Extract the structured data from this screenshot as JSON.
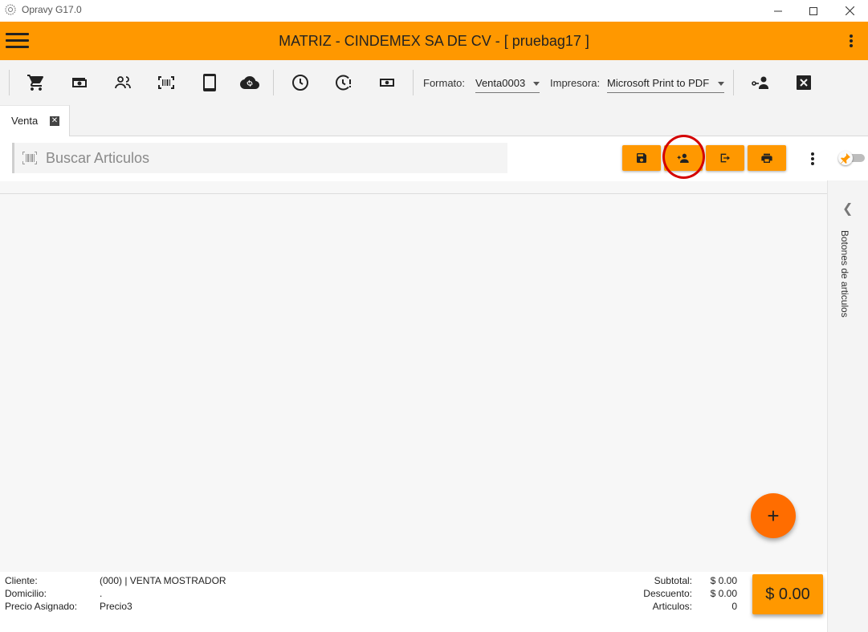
{
  "window": {
    "title": "Opravy G17.0"
  },
  "appbar": {
    "title": "MATRIZ - CINDEMEX SA DE CV - [ pruebag17 ]"
  },
  "toolbar": {
    "formato_label": "Formato:",
    "formato_value": "Venta0003",
    "impresora_label": "Impresora:",
    "impresora_value": "Microsoft Print to PDF"
  },
  "tabs": [
    {
      "label": "Venta"
    }
  ],
  "search": {
    "placeholder": "Buscar Articulos"
  },
  "side_panel": {
    "label": "Botones de articulos"
  },
  "footer": {
    "cliente_label": "Cliente:",
    "cliente_value": "(000) | VENTA MOSTRADOR",
    "domicilio_label": "Domicilio:",
    "domicilio_value": ".",
    "precio_label": "Precio Asignado:",
    "precio_value": "Precio3",
    "subtotal_label": "Subtotal:",
    "subtotal_value": "$ 0.00",
    "descuento_label": "Descuento:",
    "descuento_value": "$ 0.00",
    "articulos_label": "Articulos:",
    "articulos_value": "0",
    "total": "$ 0.00"
  },
  "colors": {
    "accent": "#ff9800",
    "fab": "#ff6d00",
    "highlight": "#d40000"
  }
}
